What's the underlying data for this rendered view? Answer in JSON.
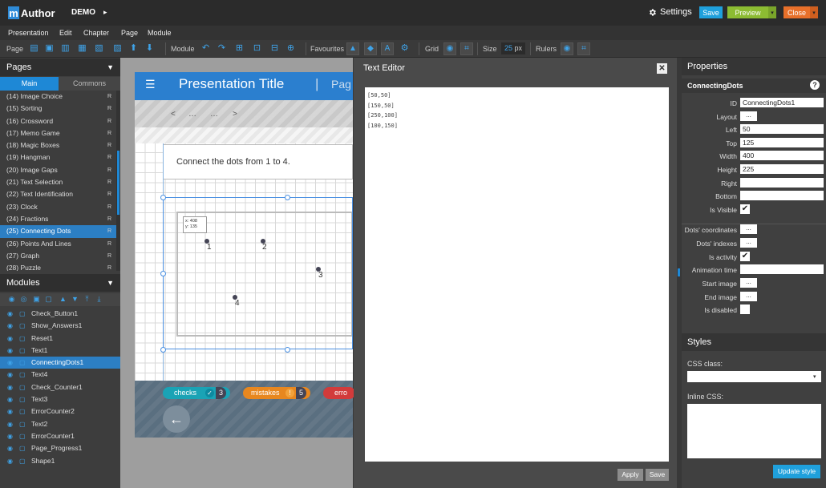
{
  "app": {
    "logo_m": "m",
    "logo_text": "Author",
    "project": "DEMO",
    "project_arrow": "▸"
  },
  "topbar": {
    "settings": "Settings",
    "save": "Save",
    "preview": "Preview",
    "close": "Close",
    "dropdown": "▾"
  },
  "menu": [
    "Presentation",
    "Edit",
    "Chapter",
    "Page",
    "Module"
  ],
  "toolbar": {
    "page_label": "Page",
    "module_label": "Module",
    "favourites_label": "Favourites",
    "grid_label": "Grid",
    "size_label": "Size",
    "size_value": "25",
    "size_unit": "px",
    "rulers_label": "Rulers"
  },
  "pages": {
    "title": "Pages",
    "arrow": "▼",
    "tab_main": "Main",
    "tab_commons": "Commons",
    "items": [
      {
        "label": "(14) Image Choice",
        "r": "R"
      },
      {
        "label": "(15) Sorting",
        "r": "R"
      },
      {
        "label": "(16) Crossword",
        "r": "R"
      },
      {
        "label": "(17) Memo Game",
        "r": "R"
      },
      {
        "label": "(18) Magic Boxes",
        "r": "R"
      },
      {
        "label": "(19) Hangman",
        "r": "R"
      },
      {
        "label": "(20) Image Gaps",
        "r": "R"
      },
      {
        "label": "(21) Text Selection",
        "r": "R"
      },
      {
        "label": "(22) Text Identification",
        "r": "R"
      },
      {
        "label": "(23) Clock",
        "r": "R"
      },
      {
        "label": "(24) Fractions",
        "r": "R"
      },
      {
        "label": "(25) Connecting Dots",
        "r": "R"
      },
      {
        "label": "(26) Points And Lines",
        "r": "R"
      },
      {
        "label": "(27) Graph",
        "r": "R"
      },
      {
        "label": "(28) Puzzle",
        "r": "R"
      }
    ],
    "active_index": 11
  },
  "modules": {
    "title": "Modules",
    "arrow": "▼",
    "items": [
      "Check_Button1",
      "Show_Answers1",
      "Reset1",
      "Text1",
      "ConnectingDots1",
      "Text4",
      "Check_Counter1",
      "Text3",
      "ErrorCounter2",
      "Text2",
      "ErrorCounter1",
      "Page_Progress1",
      "Shape1"
    ],
    "active_index": 4
  },
  "canvas": {
    "presentation_title": "Presentation Title",
    "header_sep": "|",
    "header_page": "Pag",
    "nav_prev": "<",
    "nav_dots1": "…",
    "nav_dots2": "…",
    "nav_next": ">",
    "text1": "Connect the dots from 1 to 4.",
    "coord_x": "x: 408",
    "coord_y": "y: 135",
    "dots": [
      {
        "label": "1"
      },
      {
        "label": "2"
      },
      {
        "label": "3"
      },
      {
        "label": "4"
      }
    ],
    "checks_label": "checks",
    "checks_count": "3",
    "mistakes_label": "mistakes",
    "mistakes_count": "5",
    "errors_label": "erro"
  },
  "editor": {
    "title": "Text Editor",
    "close": "✕",
    "content": "[50,50]\n[150,50]\n[250,100]\n[100,150]",
    "apply": "Apply",
    "save": "Save"
  },
  "properties": {
    "title": "Properties",
    "module_name": "ConnectingDots",
    "help": "?",
    "id_label": "ID",
    "id_value": "ConnectingDots1",
    "layout_label": "Layout",
    "left_label": "Left",
    "left_value": "50",
    "top_label": "Top",
    "top_value": "125",
    "width_label": "Width",
    "width_value": "400",
    "height_label": "Height",
    "height_value": "225",
    "right_label": "Right",
    "bottom_label": "Bottom",
    "visible_label": "Is Visible",
    "dots_coords_label": "Dots' coordinates",
    "dots_indexes_label": "Dots' indexes",
    "is_activity_label": "Is activity",
    "anim_time_label": "Animation time",
    "start_image_label": "Start image",
    "end_image_label": "End image",
    "is_disabled_label": "Is disabled",
    "ellipsis": "...",
    "check": "✔"
  },
  "styles": {
    "title": "Styles",
    "css_class_label": "CSS class:",
    "inline_css_label": "Inline CSS:",
    "update": "Update style",
    "select_arrow": "▾"
  },
  "colors": {
    "accent": "#1e88d6",
    "save": "#1fa0dc",
    "preview": "#8cbc32",
    "close": "#e8702a"
  }
}
